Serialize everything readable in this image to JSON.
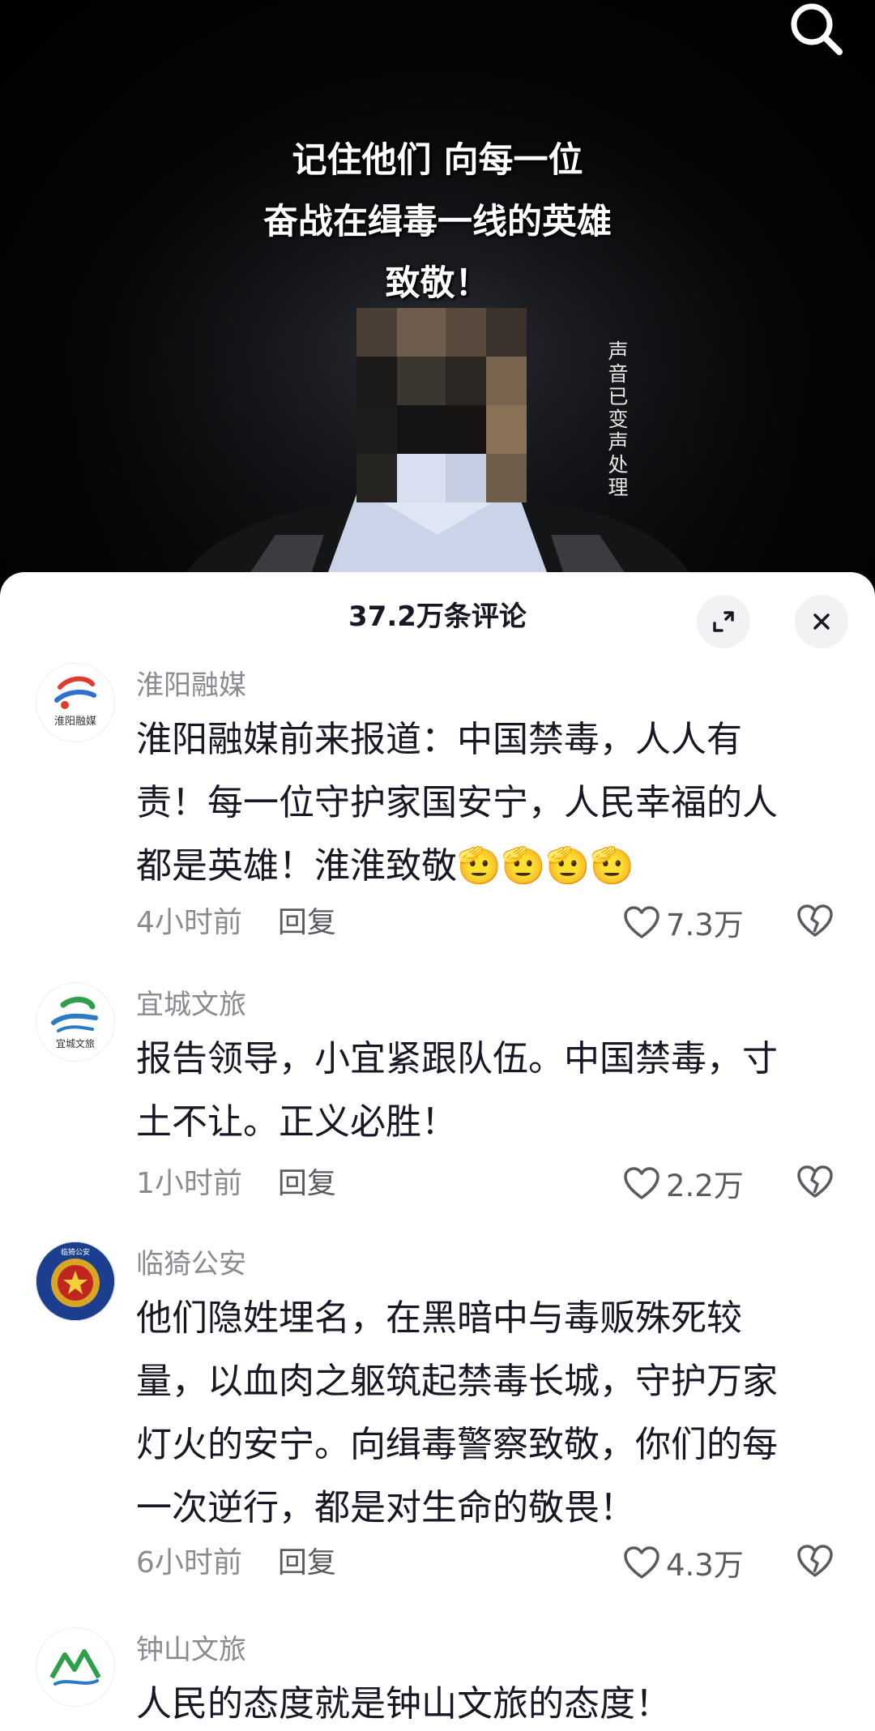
{
  "video": {
    "caption_lines": [
      "记住他们 向每一位",
      "奋战在缉毒一线的英雄",
      "致敬！"
    ],
    "voice_note_chars": [
      "声",
      "音",
      "已",
      "变",
      "声",
      "处",
      "理"
    ]
  },
  "comments_panel": {
    "title": "37.2万条评论",
    "comments": [
      {
        "username": "淮阳融媒",
        "avatar_text": "淮阳融媒",
        "lines": [
          "淮阳融媒前来报道：中国禁毒，人人有",
          "责！每一位守护家国安宁，人民幸福的人",
          "都是英雄！淮淮致敬🫡🫡🫡🫡"
        ],
        "time": "4小时前",
        "reply_label": "回复",
        "likes": "7.3万"
      },
      {
        "username": "宜城文旅",
        "avatar_text": "宜城文旅",
        "lines": [
          "报告领导，小宜紧跟队伍。中国禁毒，寸",
          "土不让。正义必胜！"
        ],
        "time": "1小时前",
        "reply_label": "回复",
        "likes": "2.2万"
      },
      {
        "username": "临猗公安",
        "avatar_text": "临猗公安",
        "lines": [
          "他们隐姓埋名，在黑暗中与毒贩殊死较",
          "量，以血肉之躯筑起禁毒长城，守护万家",
          "灯火的安宁。向缉毒警察致敬，你们的每",
          "一次逆行，都是对生命的敬畏！"
        ],
        "time": "6小时前",
        "reply_label": "回复",
        "likes": "4.3万"
      },
      {
        "username": "钟山文旅",
        "lines": [
          "人民的态度就是钟山文旅的态度！"
        ]
      }
    ]
  },
  "colors": {
    "sheet_bg": "#ffffff",
    "text_primary": "#161823",
    "text_secondary": "#8a8b91",
    "button_bg": "#f2f2f4"
  }
}
